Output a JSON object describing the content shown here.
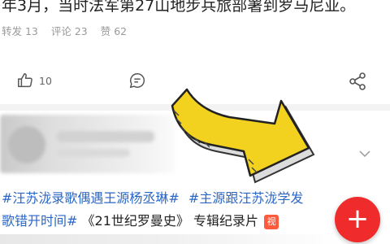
{
  "post": {
    "text": "年3月，当时法军第27山地步兵旅部署到罗马尼亚。",
    "repost_label": "转发 13",
    "comment_label": "评论 23",
    "like_label": "赞 62"
  },
  "actions": {
    "like_count": "10",
    "like_icon": "thumbs-up-icon",
    "comment_icon": "comment-bubble-icon",
    "share_icon": "share-icon"
  },
  "next_post": {
    "topics": [
      "#汪苏泷录歌偶遇王源杨丞琳#",
      "#主源跟汪苏泷学发"
    ],
    "line2_text": "歌错开时间#",
    "line2_tag": "《21世纪罗曼史》",
    "line2_suffix": "专辑纪录片",
    "badge_text": "视"
  },
  "fab": {
    "label": "+",
    "color": "#ef2b2b"
  },
  "overlay": {
    "arrow_color": "#f2d21f",
    "icon": "arrow-annotation-icon"
  }
}
